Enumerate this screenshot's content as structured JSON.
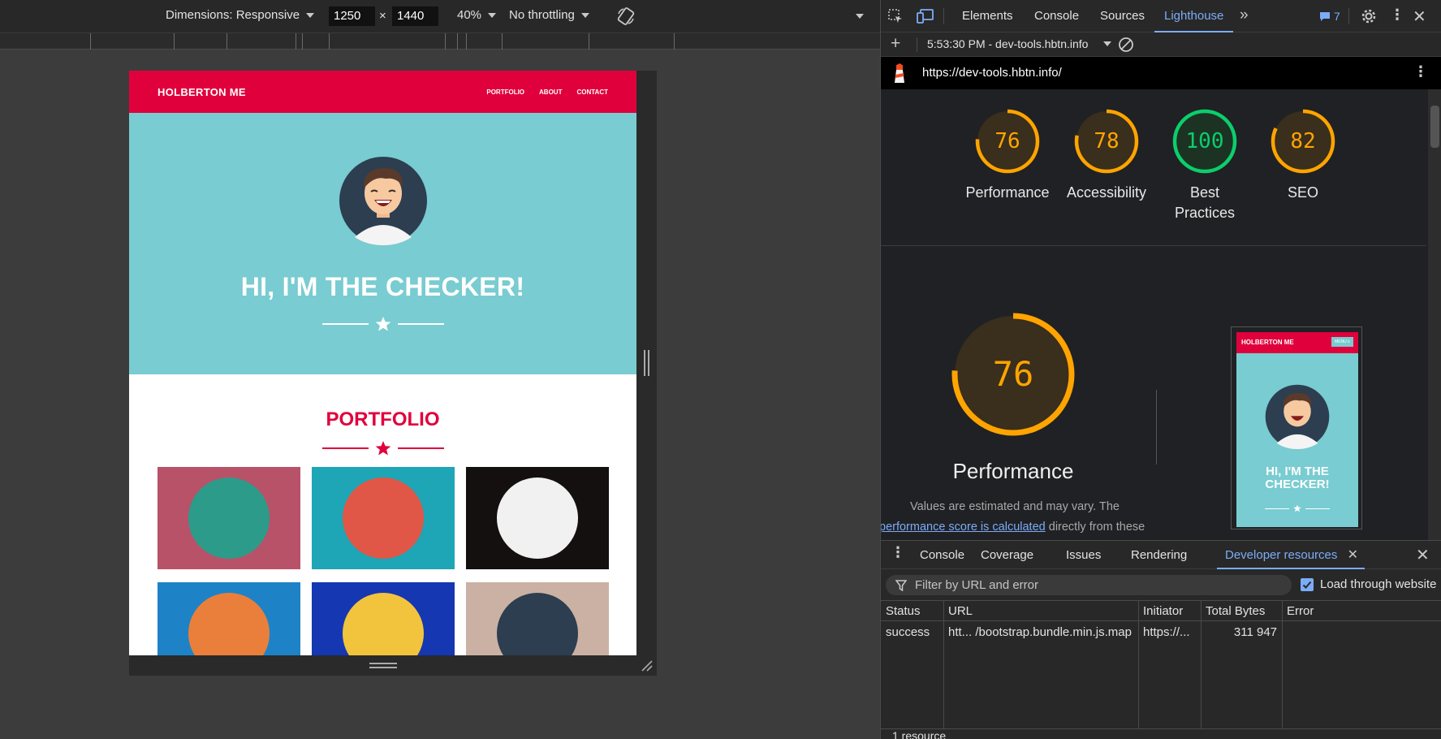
{
  "device_toolbar": {
    "dimensions_label": "Dimensions: Responsive",
    "width": "1250",
    "height": "1440",
    "times": "×",
    "zoom": "40%",
    "throttling": "No throttling"
  },
  "site": {
    "brand": "HOLBERTON ME",
    "nav": [
      "PORTFOLIO",
      "ABOUT",
      "CONTACT"
    ],
    "hero_title": "HI, I'M THE CHECKER!",
    "portfolio_title": "PORTFOLIO",
    "colors": {
      "primary": "#e0003c",
      "hero": "#79ccd1"
    },
    "tiles": [
      {
        "bg": "#b85268",
        "circle": "#2c9b8a",
        "icon": "cabin-icon"
      },
      {
        "bg": "#1ea5b6",
        "circle": "#e15747",
        "icon": "cake-icon"
      },
      {
        "bg": "#141010",
        "circle": "#f1f1f1",
        "icon": "circus-tent-icon"
      },
      {
        "bg": "#1e82c6",
        "circle": "#ea7f3b",
        "icon": "game-controller-icon"
      },
      {
        "bg": "#1637b2",
        "circle": "#f2c43d",
        "icon": "safe-icon"
      },
      {
        "bg": "#cbb1a3",
        "circle": "#2c3e50",
        "icon": "submarine-icon"
      }
    ]
  },
  "devtools": {
    "tabs": [
      "Elements",
      "Console",
      "Sources",
      "Lighthouse"
    ],
    "active_tab": "Lighthouse",
    "issues_count": "7",
    "report_label": "5:53:30 PM - dev-tools.hbtn.info",
    "url": "https://dev-tools.hbtn.info/",
    "scores": [
      {
        "value": "76",
        "label": "Performance",
        "color": "#ffa400"
      },
      {
        "value": "78",
        "label": "Accessibility",
        "color": "#ffa400"
      },
      {
        "value": "100",
        "label": "Best Practices",
        "color": "#0cce6b"
      },
      {
        "value": "82",
        "label": "SEO",
        "color": "#ffa400"
      }
    ],
    "main_score": {
      "value": "76",
      "label": "Performance"
    },
    "description_line1": "Values are estimated and may vary. The",
    "description_link": "performance score is calculated",
    "description_rest": "directly from these",
    "preview": {
      "brand": "HOLBERTON ME",
      "button": "MENU ≡",
      "title": "HI, I'M THE CHECKER!"
    }
  },
  "drawer": {
    "tabs": [
      "Console",
      "Coverage",
      "Issues",
      "Rendering",
      "Developer resources"
    ],
    "active_tab": "Developer resources",
    "filter_placeholder": "Filter by URL and error",
    "load_through_label": "Load through website",
    "load_through_checked": true,
    "columns": [
      "Status",
      "URL",
      "Initiator",
      "Total Bytes",
      "Error"
    ],
    "rows": [
      {
        "status": "success",
        "url": "htt... /bootstrap.bundle.min.js.map",
        "initiator": "https://...",
        "bytes": "311 947",
        "error": ""
      }
    ],
    "footer": "1 resource"
  }
}
